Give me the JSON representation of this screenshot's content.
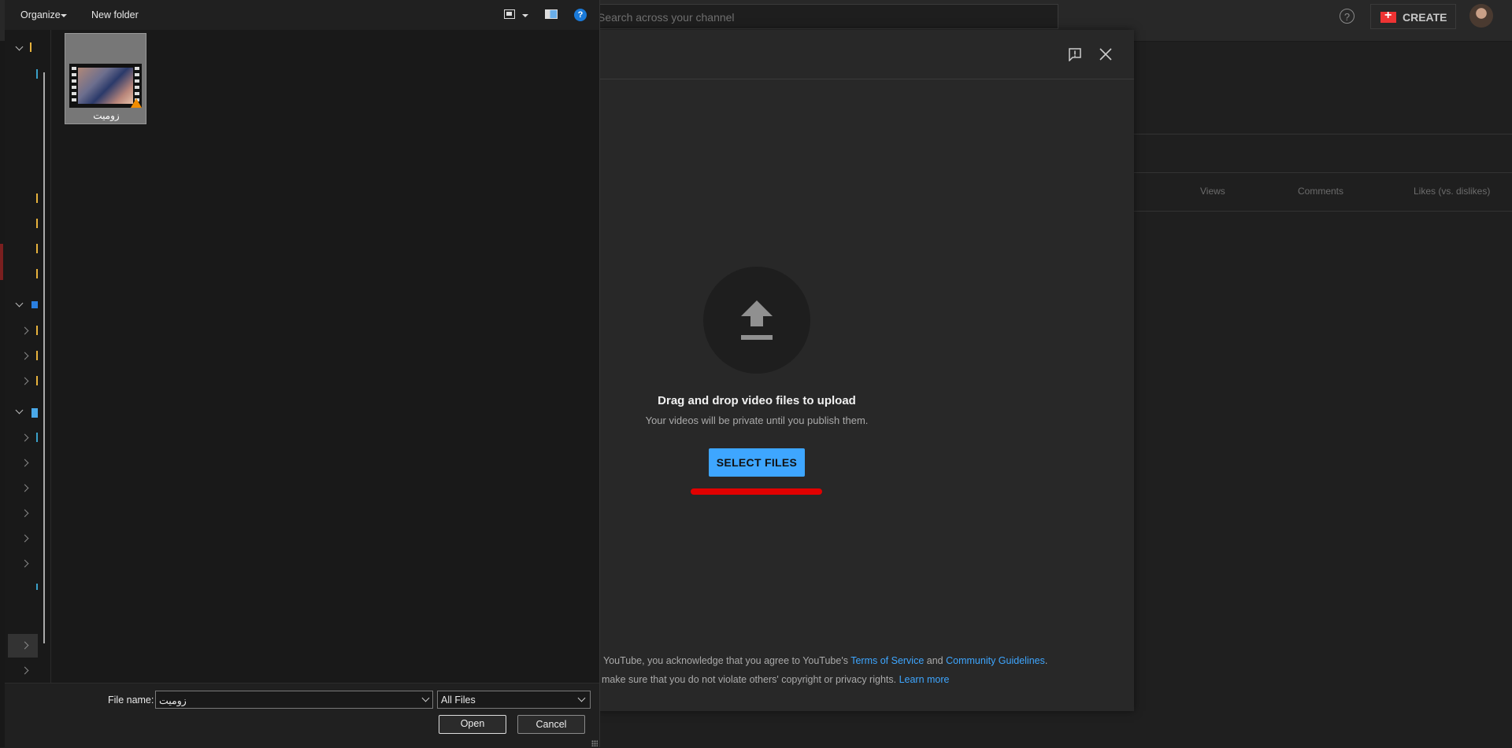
{
  "youtube": {
    "search_placeholder": "Search across your channel",
    "help_glyph": "?",
    "create_label": "CREATE",
    "columns": [
      "Views",
      "Comments",
      "Likes (vs. dislikes)"
    ]
  },
  "upload_dialog": {
    "title": "Drag and drop video files to upload",
    "subtitle": "Your videos will be private until you publish them.",
    "select_button": "SELECT FILES",
    "legal_line1_pre": "YouTube, you acknowledge that you agree to YouTube's ",
    "terms_link": "Terms of Service",
    "legal_line1_and": " and ",
    "guidelines_link": "Community Guidelines",
    "legal_line1_end": ".",
    "legal_line2_pre": "make sure that you do not violate others' copyright or privacy rights. ",
    "learn_more_link": "Learn more"
  },
  "file_dialog": {
    "toolbar": {
      "organize_label": "Organize",
      "new_folder_label": "New folder",
      "help_glyph": "?"
    },
    "files": [
      {
        "name": "زوميت"
      }
    ],
    "file_name_label": "File name:",
    "file_name_value": "زوميت",
    "file_type": "All Files",
    "open_label": "Open",
    "cancel_label": "Cancel"
  }
}
